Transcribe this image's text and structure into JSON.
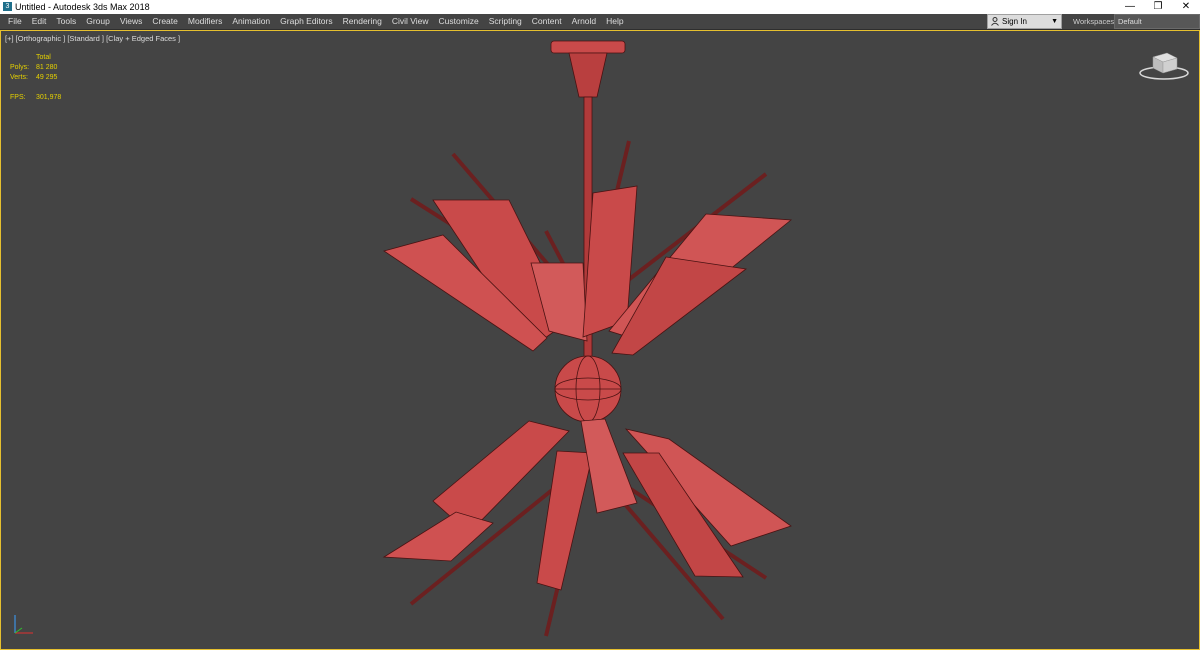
{
  "window": {
    "title": "Untitled - Autodesk 3ds Max 2018",
    "app_icon": "3",
    "controls": {
      "minimize": "—",
      "restore": "❐",
      "close": "✕"
    }
  },
  "menu": {
    "items": [
      "File",
      "Edit",
      "Tools",
      "Group",
      "Views",
      "Create",
      "Modifiers",
      "Animation",
      "Graph Editors",
      "Rendering",
      "Civil View",
      "Customize",
      "Scripting",
      "Content",
      "Arnold",
      "Help"
    ]
  },
  "account": {
    "signin_label": "Sign In"
  },
  "workspace": {
    "label": "Workspaces:",
    "value": "Default"
  },
  "viewport": {
    "label": "[+] [Orthographic ] [Standard ] [Clay + Edged Faces ]",
    "stats": {
      "header": "Total",
      "polys_label": "Polys:",
      "polys_value": "81 280",
      "verts_label": "Verts:",
      "verts_value": "49 295",
      "fps_label": "FPS:",
      "fps_value": "301,978"
    }
  },
  "colors": {
    "viewport_bg": "#444444",
    "viewport_border": "#e6c02f",
    "model_fill": "#c94a4a",
    "model_edge": "#4a1212",
    "stats_text": "#e5d100"
  }
}
